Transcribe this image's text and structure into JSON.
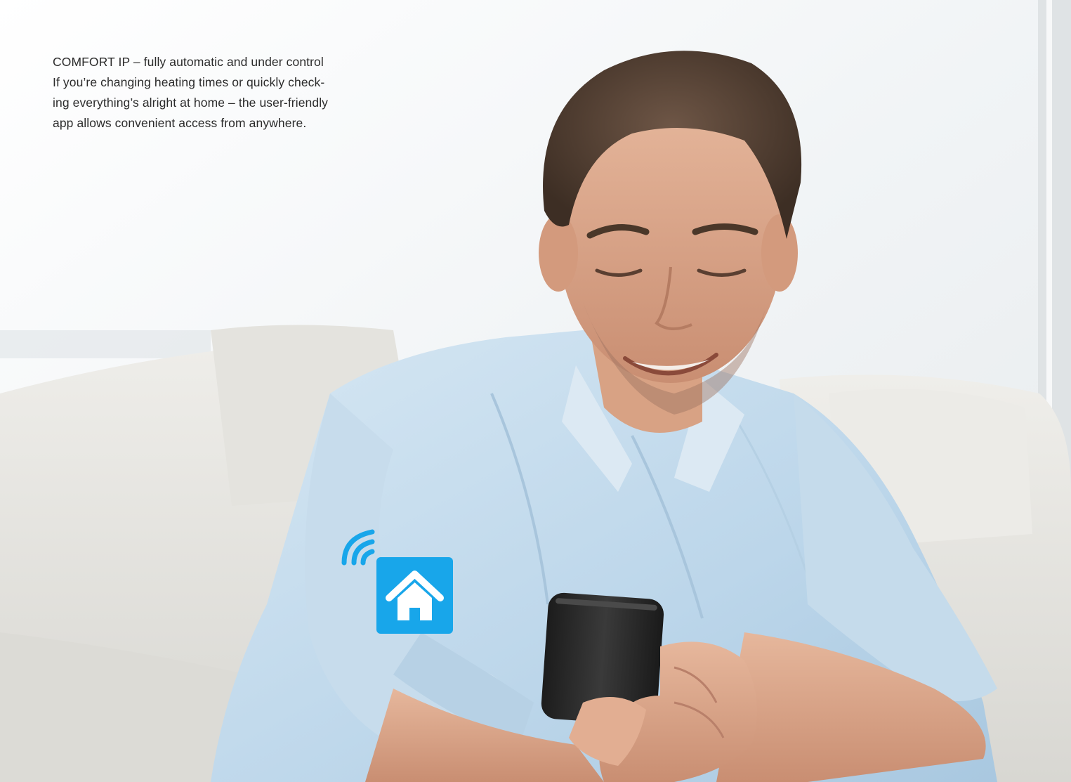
{
  "caption": {
    "line1": "COMFORT IP – fully automatic and under control",
    "line2": "If you’re changing heating times or quickly check-",
    "line3": "ing everything’s alright at home – the user-friendly",
    "line4": "app allows convenient access from anywhere."
  },
  "icons": {
    "wifi": "wifi-signal-icon",
    "home": "home-icon"
  },
  "colors": {
    "accent": "#18a6ea",
    "shirt": "#c9dfee",
    "sofa": "#e9e8e4",
    "background": "#f3f6f8"
  }
}
